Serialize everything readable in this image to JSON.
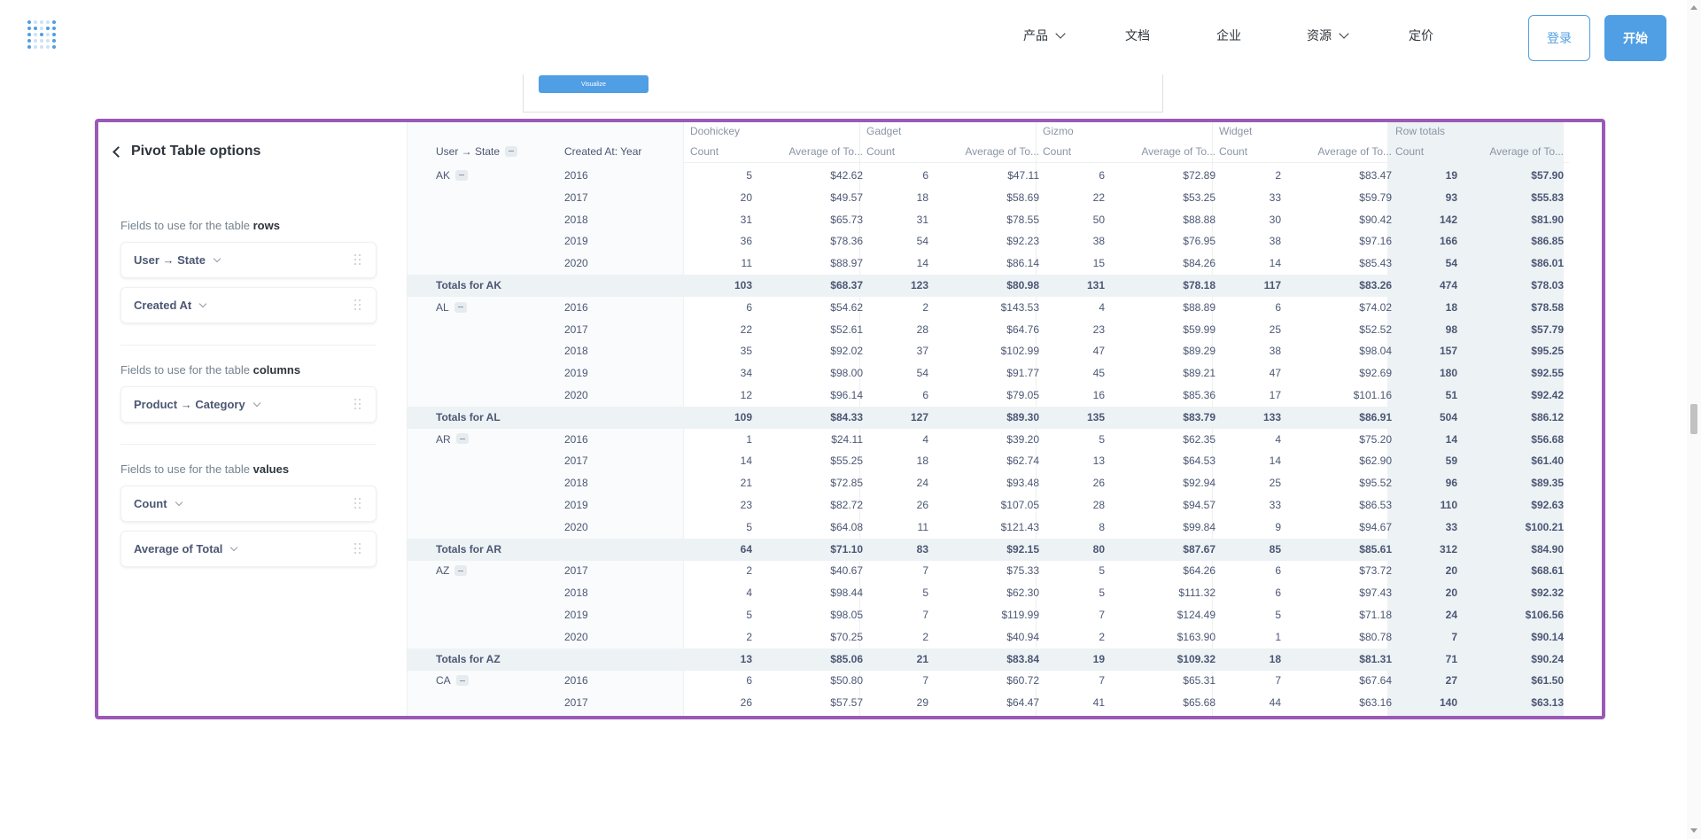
{
  "nav": {
    "items": [
      {
        "label": "产品",
        "has_dropdown": true
      },
      {
        "label": "文档",
        "has_dropdown": false
      },
      {
        "label": "企业",
        "has_dropdown": false
      },
      {
        "label": "资源",
        "has_dropdown": true
      },
      {
        "label": "定价",
        "has_dropdown": false
      }
    ],
    "login_label": "登录",
    "start_label": "开始"
  },
  "prev_panel": {
    "visualize_label": "Visualize"
  },
  "sidebar": {
    "title": "Pivot Table options",
    "sections": [
      {
        "label_prefix": "Fields to use for the table",
        "label_keyword": "rows",
        "fields": [
          "User → State",
          "Created At"
        ]
      },
      {
        "label_prefix": "Fields to use for the table",
        "label_keyword": "columns",
        "fields": [
          "Product → Category"
        ]
      },
      {
        "label_prefix": "Fields to use for the table",
        "label_keyword": "values",
        "fields": [
          "Count",
          "Average of Total"
        ]
      }
    ]
  },
  "pivot": {
    "row_headers": [
      "User → State",
      "Created At: Year"
    ],
    "column_groups": [
      "Doohickey",
      "Gadget",
      "Gizmo",
      "Widget",
      "Row totals"
    ],
    "value_headers": [
      "Count",
      "Average of To..."
    ],
    "states": [
      {
        "state": "AK",
        "rows": [
          {
            "year": "2016",
            "values": [
              "5",
              "$42.62",
              "6",
              "$47.11",
              "6",
              "$72.89",
              "2",
              "$83.47",
              "19",
              "$57.90"
            ]
          },
          {
            "year": "2017",
            "values": [
              "20",
              "$49.57",
              "18",
              "$58.69",
              "22",
              "$53.25",
              "33",
              "$59.79",
              "93",
              "$55.83"
            ]
          },
          {
            "year": "2018",
            "values": [
              "31",
              "$65.73",
              "31",
              "$78.55",
              "50",
              "$88.88",
              "30",
              "$90.42",
              "142",
              "$81.90"
            ]
          },
          {
            "year": "2019",
            "values": [
              "36",
              "$78.36",
              "54",
              "$92.23",
              "38",
              "$76.95",
              "38",
              "$97.16",
              "166",
              "$86.85"
            ]
          },
          {
            "year": "2020",
            "values": [
              "11",
              "$88.97",
              "14",
              "$86.14",
              "15",
              "$84.26",
              "14",
              "$85.43",
              "54",
              "$86.01"
            ]
          }
        ],
        "total_label": "Totals for AK",
        "totals": [
          "103",
          "$68.37",
          "123",
          "$80.98",
          "131",
          "$78.18",
          "117",
          "$83.26",
          "474",
          "$78.03"
        ]
      },
      {
        "state": "AL",
        "rows": [
          {
            "year": "2016",
            "values": [
              "6",
              "$54.62",
              "2",
              "$143.53",
              "4",
              "$88.89",
              "6",
              "$74.02",
              "18",
              "$78.58"
            ]
          },
          {
            "year": "2017",
            "values": [
              "22",
              "$52.61",
              "28",
              "$64.76",
              "23",
              "$59.99",
              "25",
              "$52.52",
              "98",
              "$57.79"
            ]
          },
          {
            "year": "2018",
            "values": [
              "35",
              "$92.02",
              "37",
              "$102.99",
              "47",
              "$89.29",
              "38",
              "$98.04",
              "157",
              "$95.25"
            ]
          },
          {
            "year": "2019",
            "values": [
              "34",
              "$98.00",
              "54",
              "$91.77",
              "45",
              "$89.21",
              "47",
              "$92.69",
              "180",
              "$92.55"
            ]
          },
          {
            "year": "2020",
            "values": [
              "12",
              "$96.14",
              "6",
              "$79.05",
              "16",
              "$85.36",
              "17",
              "$101.16",
              "51",
              "$92.42"
            ]
          }
        ],
        "total_label": "Totals for AL",
        "totals": [
          "109",
          "$84.33",
          "127",
          "$89.30",
          "135",
          "$83.79",
          "133",
          "$86.91",
          "504",
          "$86.12"
        ]
      },
      {
        "state": "AR",
        "rows": [
          {
            "year": "2016",
            "values": [
              "1",
              "$24.11",
              "4",
              "$39.20",
              "5",
              "$62.35",
              "4",
              "$75.20",
              "14",
              "$56.68"
            ]
          },
          {
            "year": "2017",
            "values": [
              "14",
              "$55.25",
              "18",
              "$62.74",
              "13",
              "$64.53",
              "14",
              "$62.90",
              "59",
              "$61.40"
            ]
          },
          {
            "year": "2018",
            "values": [
              "21",
              "$72.85",
              "24",
              "$93.48",
              "26",
              "$92.94",
              "25",
              "$95.52",
              "96",
              "$89.35"
            ]
          },
          {
            "year": "2019",
            "values": [
              "23",
              "$82.72",
              "26",
              "$107.05",
              "28",
              "$94.57",
              "33",
              "$86.53",
              "110",
              "$92.63"
            ]
          },
          {
            "year": "2020",
            "values": [
              "5",
              "$64.08",
              "11",
              "$121.43",
              "8",
              "$99.84",
              "9",
              "$94.67",
              "33",
              "$100.21"
            ]
          }
        ],
        "total_label": "Totals for AR",
        "totals": [
          "64",
          "$71.10",
          "83",
          "$92.15",
          "80",
          "$87.67",
          "85",
          "$85.61",
          "312",
          "$84.90"
        ]
      },
      {
        "state": "AZ",
        "rows": [
          {
            "year": "2017",
            "values": [
              "2",
              "$40.67",
              "7",
              "$75.33",
              "5",
              "$64.26",
              "6",
              "$73.72",
              "20",
              "$68.61"
            ]
          },
          {
            "year": "2018",
            "values": [
              "4",
              "$98.44",
              "5",
              "$62.30",
              "5",
              "$111.32",
              "6",
              "$97.43",
              "20",
              "$92.32"
            ]
          },
          {
            "year": "2019",
            "values": [
              "5",
              "$98.05",
              "7",
              "$119.99",
              "7",
              "$124.49",
              "5",
              "$71.18",
              "24",
              "$106.56"
            ]
          },
          {
            "year": "2020",
            "values": [
              "2",
              "$70.25",
              "2",
              "$40.94",
              "2",
              "$163.90",
              "1",
              "$80.78",
              "7",
              "$90.14"
            ]
          }
        ],
        "total_label": "Totals for AZ",
        "totals": [
          "13",
          "$85.06",
          "21",
          "$83.84",
          "19",
          "$109.32",
          "18",
          "$81.31",
          "71",
          "$90.24"
        ]
      },
      {
        "state": "CA",
        "rows": [
          {
            "year": "2016",
            "values": [
              "6",
              "$50.80",
              "7",
              "$60.72",
              "7",
              "$65.31",
              "7",
              "$67.64",
              "27",
              "$61.50"
            ]
          },
          {
            "year": "2017",
            "values": [
              "26",
              "$57.57",
              "29",
              "$64.47",
              "41",
              "$65.68",
              "44",
              "$63.16",
              "140",
              "$63.13"
            ]
          }
        ],
        "total_label": "",
        "totals": []
      }
    ]
  }
}
